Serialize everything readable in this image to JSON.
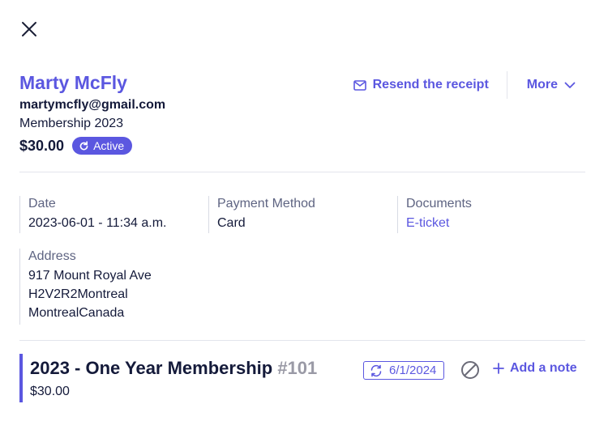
{
  "header": {
    "name": "Marty McFly",
    "email": "martymcfly@gmail.com",
    "product": "Membership 2023",
    "amount": "$30.00",
    "status": "Active"
  },
  "actions": {
    "resend_label": "Resend the receipt",
    "more_label": "More"
  },
  "details": {
    "date": {
      "label": "Date",
      "value": "2023-06-01 - 11:34 a.m."
    },
    "payment": {
      "label": "Payment Method",
      "value": "Card"
    },
    "documents": {
      "label": "Documents",
      "value": "E-ticket"
    },
    "address": {
      "label": "Address",
      "line1": "917 Mount Royal Ave",
      "line2": "H2V2R2Montreal",
      "line3": "MontrealCanada"
    }
  },
  "item": {
    "title": "2023 - One Year Membership",
    "number": "#101",
    "price": "$30.00",
    "renewal_date": "6/1/2024",
    "add_note_label": "Add a note"
  },
  "colors": {
    "accent": "#5b57e0",
    "text": "#141a3a",
    "muted": "#5e6482",
    "divider": "#e3e5ec"
  },
  "icons": [
    "close-icon",
    "refresh-icon",
    "mail-icon",
    "chevron-down-icon",
    "renew-icon",
    "cancel-icon",
    "plus-icon"
  ]
}
